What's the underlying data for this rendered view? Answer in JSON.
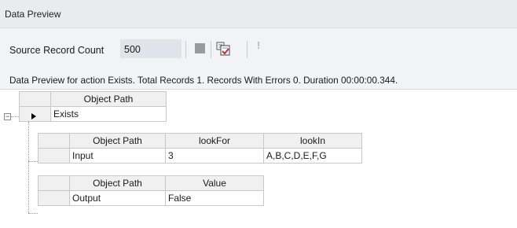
{
  "title": "Data Preview",
  "toolbar": {
    "source_label": "Source Record Count",
    "source_value": "500",
    "stop_icon": "stop-icon",
    "preview_icon": "preview-check-icon",
    "error_icon": "exclamation-icon"
  },
  "status_text": "Data Preview for action Exists. Total Records 1. Records With Errors 0. Duration 00:00:00.344.",
  "root_grid": {
    "header": "Object Path",
    "row_value": "Exists",
    "expander": "−"
  },
  "input_grid": {
    "headers": [
      "Object Path",
      "lookFor",
      "lookIn"
    ],
    "row": [
      "Input",
      "3",
      "A,B,C,D,E,F,G"
    ]
  },
  "output_grid": {
    "headers": [
      "Object Path",
      "Value"
    ],
    "row": [
      "Output",
      "False"
    ]
  }
}
